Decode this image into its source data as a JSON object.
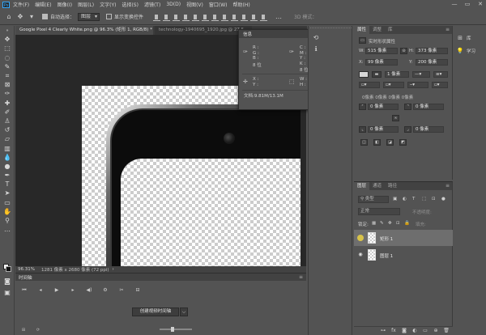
{
  "menubar": {
    "logo": "Ps",
    "items": [
      "文件(F)",
      "编辑(E)",
      "图像(I)",
      "图层(L)",
      "文字(Y)",
      "选择(S)",
      "滤镜(T)",
      "3D(D)",
      "视图(V)",
      "窗口(W)",
      "帮助(H)"
    ],
    "window_buttons": [
      "—",
      "▭",
      "✕"
    ]
  },
  "optionsbar": {
    "auto_select_label": "自动选择：",
    "auto_select_value": "图层",
    "show_transform_label": "显示变换控件",
    "mode_3d_label": "3D 模式："
  },
  "doc_tabs": [
    {
      "label": "Google Pixel 4 Clearly White.png @ 96.3% (矩形 1, RGB/8) *",
      "close": "×"
    },
    {
      "label": "technology-1940695_1920.jpg @ 27.5..."
    }
  ],
  "info_panel": {
    "title": "信息",
    "rgb_labels": "R :\nG :\nB :",
    "cmyk_labels": "C :\nM :\nY :\nK :",
    "depth_left": "8 位",
    "depth_right": "8 位",
    "xy_labels": "X :\nY :",
    "wh_labels": "W :\nH :",
    "doc_size": "文档:9.81M/13.1M"
  },
  "statusbar": {
    "zoom": "96.31%",
    "doc_info": "1281 像素 x 2680 像素 (72 ppi)",
    "arrow": "›"
  },
  "timeline": {
    "title": "时间轴",
    "create_button": "创建视频时间轴",
    "dropdown": "⌵"
  },
  "properties": {
    "tabs": [
      "属性",
      "调整",
      "库"
    ],
    "section_label": "实时形状属性",
    "w_label": "W:",
    "w_value": "515 像素",
    "h_label": "H:",
    "h_value": "373 像素",
    "x_label": "X:",
    "x_value": "99 像素",
    "y_label": "Y:",
    "y_value": "200 像素",
    "stroke_width": "1 像素",
    "radii_summary": "0像素 0像素 0像素 0像素",
    "radius_values": [
      "0 像素",
      "0 像素",
      "0 像素",
      "0 像素"
    ]
  },
  "layers": {
    "tabs": [
      "图层",
      "通道",
      "路径"
    ],
    "kind_filter": "类型",
    "blend_mode": "正常",
    "opacity_label": "不透明度:",
    "lock_label": "锁定:",
    "fill_label": "填充:",
    "items": [
      {
        "name": "矩形 1",
        "selected": true
      },
      {
        "name": "图层 1",
        "selected": false
      }
    ]
  },
  "right_col": {
    "items": [
      {
        "label": "库"
      },
      {
        "label": "学习"
      }
    ]
  }
}
